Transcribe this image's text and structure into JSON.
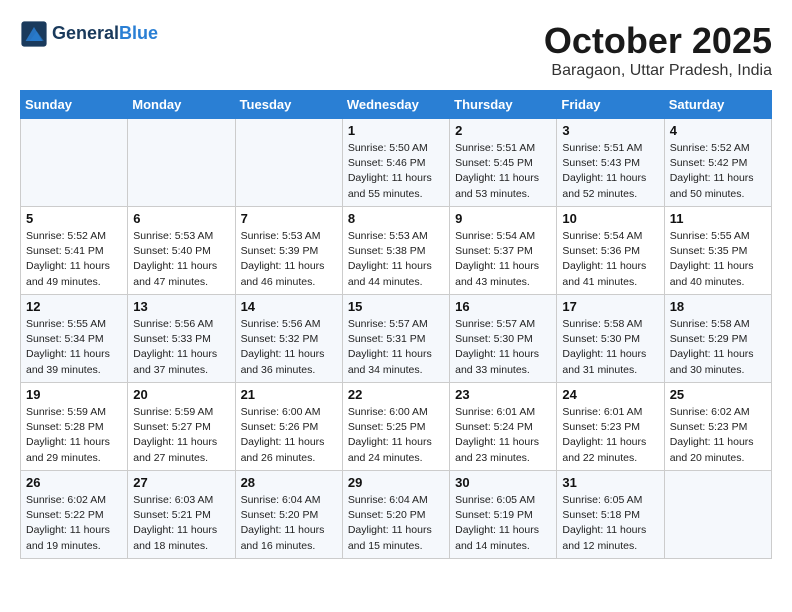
{
  "header": {
    "logo_line1": "General",
    "logo_line2": "Blue",
    "month": "October 2025",
    "location": "Baragaon, Uttar Pradesh, India"
  },
  "weekdays": [
    "Sunday",
    "Monday",
    "Tuesday",
    "Wednesday",
    "Thursday",
    "Friday",
    "Saturday"
  ],
  "weeks": [
    [
      {
        "day": "",
        "sunrise": "",
        "sunset": "",
        "daylight": ""
      },
      {
        "day": "",
        "sunrise": "",
        "sunset": "",
        "daylight": ""
      },
      {
        "day": "",
        "sunrise": "",
        "sunset": "",
        "daylight": ""
      },
      {
        "day": "1",
        "sunrise": "Sunrise: 5:50 AM",
        "sunset": "Sunset: 5:46 PM",
        "daylight": "Daylight: 11 hours and 55 minutes."
      },
      {
        "day": "2",
        "sunrise": "Sunrise: 5:51 AM",
        "sunset": "Sunset: 5:45 PM",
        "daylight": "Daylight: 11 hours and 53 minutes."
      },
      {
        "day": "3",
        "sunrise": "Sunrise: 5:51 AM",
        "sunset": "Sunset: 5:43 PM",
        "daylight": "Daylight: 11 hours and 52 minutes."
      },
      {
        "day": "4",
        "sunrise": "Sunrise: 5:52 AM",
        "sunset": "Sunset: 5:42 PM",
        "daylight": "Daylight: 11 hours and 50 minutes."
      }
    ],
    [
      {
        "day": "5",
        "sunrise": "Sunrise: 5:52 AM",
        "sunset": "Sunset: 5:41 PM",
        "daylight": "Daylight: 11 hours and 49 minutes."
      },
      {
        "day": "6",
        "sunrise": "Sunrise: 5:53 AM",
        "sunset": "Sunset: 5:40 PM",
        "daylight": "Daylight: 11 hours and 47 minutes."
      },
      {
        "day": "7",
        "sunrise": "Sunrise: 5:53 AM",
        "sunset": "Sunset: 5:39 PM",
        "daylight": "Daylight: 11 hours and 46 minutes."
      },
      {
        "day": "8",
        "sunrise": "Sunrise: 5:53 AM",
        "sunset": "Sunset: 5:38 PM",
        "daylight": "Daylight: 11 hours and 44 minutes."
      },
      {
        "day": "9",
        "sunrise": "Sunrise: 5:54 AM",
        "sunset": "Sunset: 5:37 PM",
        "daylight": "Daylight: 11 hours and 43 minutes."
      },
      {
        "day": "10",
        "sunrise": "Sunrise: 5:54 AM",
        "sunset": "Sunset: 5:36 PM",
        "daylight": "Daylight: 11 hours and 41 minutes."
      },
      {
        "day": "11",
        "sunrise": "Sunrise: 5:55 AM",
        "sunset": "Sunset: 5:35 PM",
        "daylight": "Daylight: 11 hours and 40 minutes."
      }
    ],
    [
      {
        "day": "12",
        "sunrise": "Sunrise: 5:55 AM",
        "sunset": "Sunset: 5:34 PM",
        "daylight": "Daylight: 11 hours and 39 minutes."
      },
      {
        "day": "13",
        "sunrise": "Sunrise: 5:56 AM",
        "sunset": "Sunset: 5:33 PM",
        "daylight": "Daylight: 11 hours and 37 minutes."
      },
      {
        "day": "14",
        "sunrise": "Sunrise: 5:56 AM",
        "sunset": "Sunset: 5:32 PM",
        "daylight": "Daylight: 11 hours and 36 minutes."
      },
      {
        "day": "15",
        "sunrise": "Sunrise: 5:57 AM",
        "sunset": "Sunset: 5:31 PM",
        "daylight": "Daylight: 11 hours and 34 minutes."
      },
      {
        "day": "16",
        "sunrise": "Sunrise: 5:57 AM",
        "sunset": "Sunset: 5:30 PM",
        "daylight": "Daylight: 11 hours and 33 minutes."
      },
      {
        "day": "17",
        "sunrise": "Sunrise: 5:58 AM",
        "sunset": "Sunset: 5:30 PM",
        "daylight": "Daylight: 11 hours and 31 minutes."
      },
      {
        "day": "18",
        "sunrise": "Sunrise: 5:58 AM",
        "sunset": "Sunset: 5:29 PM",
        "daylight": "Daylight: 11 hours and 30 minutes."
      }
    ],
    [
      {
        "day": "19",
        "sunrise": "Sunrise: 5:59 AM",
        "sunset": "Sunset: 5:28 PM",
        "daylight": "Daylight: 11 hours and 29 minutes."
      },
      {
        "day": "20",
        "sunrise": "Sunrise: 5:59 AM",
        "sunset": "Sunset: 5:27 PM",
        "daylight": "Daylight: 11 hours and 27 minutes."
      },
      {
        "day": "21",
        "sunrise": "Sunrise: 6:00 AM",
        "sunset": "Sunset: 5:26 PM",
        "daylight": "Daylight: 11 hours and 26 minutes."
      },
      {
        "day": "22",
        "sunrise": "Sunrise: 6:00 AM",
        "sunset": "Sunset: 5:25 PM",
        "daylight": "Daylight: 11 hours and 24 minutes."
      },
      {
        "day": "23",
        "sunrise": "Sunrise: 6:01 AM",
        "sunset": "Sunset: 5:24 PM",
        "daylight": "Daylight: 11 hours and 23 minutes."
      },
      {
        "day": "24",
        "sunrise": "Sunrise: 6:01 AM",
        "sunset": "Sunset: 5:23 PM",
        "daylight": "Daylight: 11 hours and 22 minutes."
      },
      {
        "day": "25",
        "sunrise": "Sunrise: 6:02 AM",
        "sunset": "Sunset: 5:23 PM",
        "daylight": "Daylight: 11 hours and 20 minutes."
      }
    ],
    [
      {
        "day": "26",
        "sunrise": "Sunrise: 6:02 AM",
        "sunset": "Sunset: 5:22 PM",
        "daylight": "Daylight: 11 hours and 19 minutes."
      },
      {
        "day": "27",
        "sunrise": "Sunrise: 6:03 AM",
        "sunset": "Sunset: 5:21 PM",
        "daylight": "Daylight: 11 hours and 18 minutes."
      },
      {
        "day": "28",
        "sunrise": "Sunrise: 6:04 AM",
        "sunset": "Sunset: 5:20 PM",
        "daylight": "Daylight: 11 hours and 16 minutes."
      },
      {
        "day": "29",
        "sunrise": "Sunrise: 6:04 AM",
        "sunset": "Sunset: 5:20 PM",
        "daylight": "Daylight: 11 hours and 15 minutes."
      },
      {
        "day": "30",
        "sunrise": "Sunrise: 6:05 AM",
        "sunset": "Sunset: 5:19 PM",
        "daylight": "Daylight: 11 hours and 14 minutes."
      },
      {
        "day": "31",
        "sunrise": "Sunrise: 6:05 AM",
        "sunset": "Sunset: 5:18 PM",
        "daylight": "Daylight: 11 hours and 12 minutes."
      },
      {
        "day": "",
        "sunrise": "",
        "sunset": "",
        "daylight": ""
      }
    ]
  ]
}
